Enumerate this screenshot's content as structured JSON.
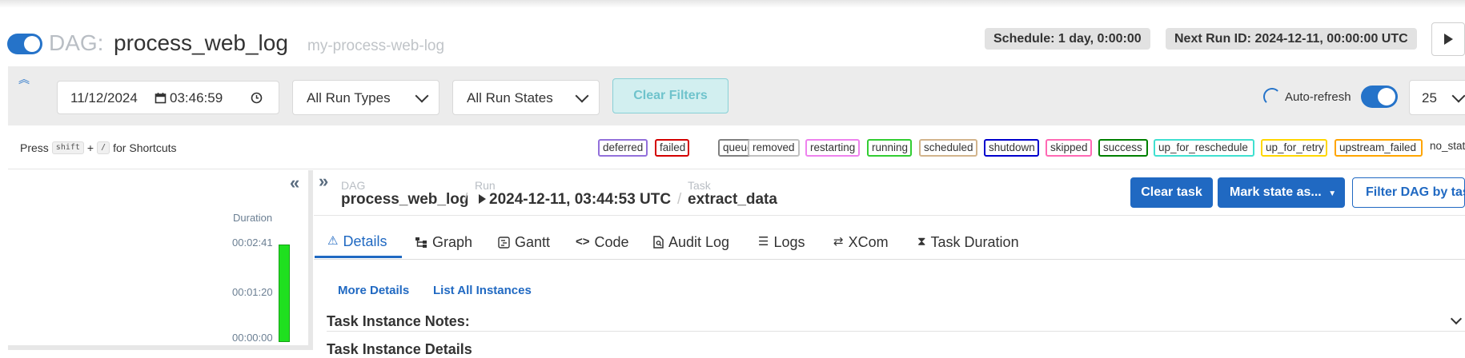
{
  "header": {
    "dag_prefix": "DAG:",
    "dag_id": "process_web_log",
    "dag_display_name": "my-process-web-log",
    "paused_toggle_on": true,
    "schedule": "Schedule: 1 day, 0:00:00",
    "next_run": "Next Run ID: 2024-12-11, 00:00:00 UTC"
  },
  "filters": {
    "date": "11/12/2024",
    "time": "03:46:59",
    "run_type": "All Run Types",
    "run_state": "All Run States",
    "clear_filters": "Clear Filters",
    "auto_refresh": "Auto-refresh",
    "page_size": "25"
  },
  "shortcuts": {
    "press": "Press",
    "shift": "shift",
    "plus": "+",
    "slash": "/",
    "for_shortcuts": "for Shortcuts"
  },
  "legend": [
    {
      "label": "deferred",
      "color": "#9370db"
    },
    {
      "label": "failed",
      "color": "#d40000"
    },
    {
      "label": "queued",
      "color": "#808080"
    },
    {
      "label": "removed",
      "color": "#c0c0c0"
    },
    {
      "label": "restarting",
      "color": "#ee82ee"
    },
    {
      "label": "running",
      "color": "#32cd32"
    },
    {
      "label": "scheduled",
      "color": "#d2b48c"
    },
    {
      "label": "shutdown",
      "color": "#0000cd"
    },
    {
      "label": "skipped",
      "color": "#ff69b4"
    },
    {
      "label": "success",
      "color": "#008000"
    },
    {
      "label": "up_for_reschedule",
      "color": "#40e0d0"
    },
    {
      "label": "up_for_retry",
      "color": "#ffd700"
    },
    {
      "label": "upstream_failed",
      "color": "#ffa500"
    },
    {
      "label": "no_status",
      "color": "#ffffff"
    }
  ],
  "grid": {
    "duration_label": "Duration",
    "ticks": [
      "00:02:41",
      "00:01:20",
      "00:00:00"
    ],
    "bar_fraction": 1.0
  },
  "breadcrumb": {
    "dag_label": "DAG",
    "dag_value": "process_web_log",
    "run_label": "Run",
    "run_value": "2024-12-11, 03:44:53 UTC",
    "task_label": "Task",
    "task_value": "extract_data",
    "sep": "/"
  },
  "actions": {
    "clear_task": "Clear task",
    "mark_state": "Mark state as...",
    "filter_dag": "Filter DAG by task"
  },
  "tabs": [
    {
      "label": "Details",
      "icon": "warning-icon"
    },
    {
      "label": "Graph",
      "icon": "graph-icon"
    },
    {
      "label": "Gantt",
      "icon": "gantt-icon"
    },
    {
      "label": "Code",
      "icon": "code-icon"
    },
    {
      "label": "Audit Log",
      "icon": "audit-log-icon"
    },
    {
      "label": "Logs",
      "icon": "logs-icon"
    },
    {
      "label": "XCom",
      "icon": "xcom-icon"
    },
    {
      "label": "Task Duration",
      "icon": "hourglass-icon"
    }
  ],
  "details": {
    "more_details": "More Details",
    "list_instances": "List All Instances",
    "notes": "Task Instance Notes:",
    "task_details": "Task Instance Details"
  }
}
